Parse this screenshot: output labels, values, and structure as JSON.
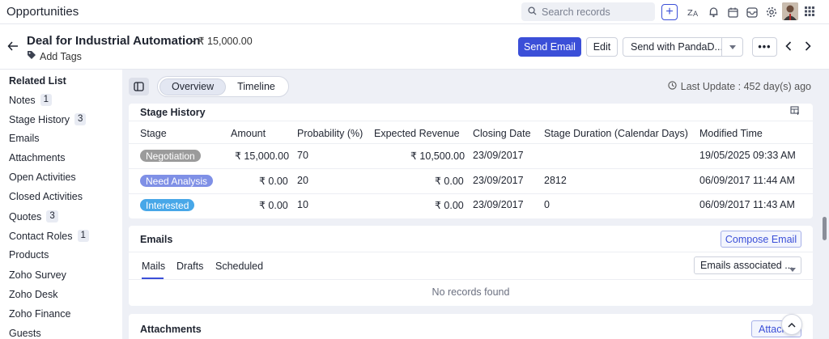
{
  "app": {
    "title": "Opportunities"
  },
  "search": {
    "placeholder": "Search records"
  },
  "record": {
    "title": "Deal for Industrial Automation",
    "amount": "- ₹ 15,000.00",
    "add_tags": "Add Tags"
  },
  "actions": {
    "send_email": "Send Email",
    "edit": "Edit",
    "send_with": "Send with PandaD...",
    "more": "•••"
  },
  "sidebar": {
    "heading": "Related List",
    "items": [
      {
        "label": "Notes",
        "count": "1"
      },
      {
        "label": "Stage History",
        "count": "3"
      },
      {
        "label": "Emails"
      },
      {
        "label": "Attachments"
      },
      {
        "label": "Open Activities"
      },
      {
        "label": "Closed Activities"
      },
      {
        "label": "Quotes",
        "count": "3"
      },
      {
        "label": "Contact Roles",
        "count": "1"
      },
      {
        "label": "Products"
      },
      {
        "label": "Zoho Survey"
      },
      {
        "label": "Zoho Desk"
      },
      {
        "label": "Zoho Finance"
      },
      {
        "label": "Guests"
      }
    ]
  },
  "tabs": {
    "overview": "Overview",
    "timeline": "Timeline"
  },
  "last_update": "Last Update : 452 day(s) ago",
  "stage_history": {
    "title": "Stage History",
    "columns": [
      "Stage",
      "Amount",
      "Probability (%)",
      "Expected Revenue",
      "Closing Date",
      "Stage Duration (Calendar Days)",
      "Modified Time"
    ],
    "rows": [
      {
        "stage": "Negotiation",
        "stage_color": "#9b9b9b",
        "amount": "₹ 15,000.00",
        "probability": "70",
        "expected_revenue": "₹ 10,500.00",
        "closing_date": "23/09/2017",
        "duration": "",
        "modified": "19/05/2025 09:33 AM"
      },
      {
        "stage": "Need Analysis",
        "stage_color": "#7f90e6",
        "amount": "₹ 0.00",
        "probability": "20",
        "expected_revenue": "₹ 0.00",
        "closing_date": "23/09/2017",
        "duration": "2812",
        "modified": "06/09/2017 11:44 AM"
      },
      {
        "stage": "Interested",
        "stage_color": "#47a7e8",
        "amount": "₹ 0.00",
        "probability": "10",
        "expected_revenue": "₹ 0.00",
        "closing_date": "23/09/2017",
        "duration": "0",
        "modified": "06/09/2017 11:43 AM"
      }
    ]
  },
  "emails": {
    "title": "Emails",
    "compose": "Compose Email",
    "tabs": [
      "Mails",
      "Drafts",
      "Scheduled"
    ],
    "filter": "Emails associated ...",
    "empty": "No records found"
  },
  "attachments": {
    "title": "Attachments",
    "button": "Attach"
  },
  "colors": {
    "accent": "#3b4fd8"
  }
}
